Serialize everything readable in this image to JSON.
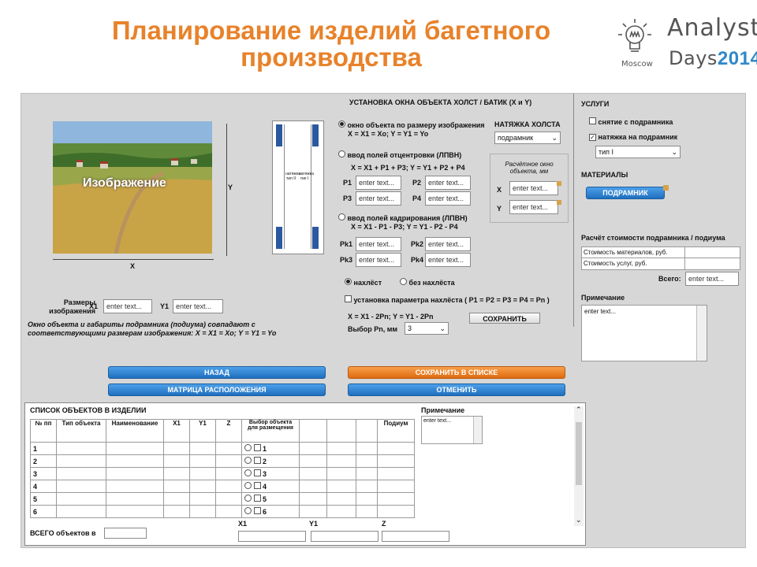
{
  "slide": {
    "title": "Планирование изделий багетного производства",
    "logo_line1": "Analyst",
    "logo_line2a": "Days",
    "logo_line2b": "2014",
    "logo_city": "Moscow"
  },
  "main": {
    "header": "УСТАНОВКА ОКНА ОБЪЕКТА ХОЛСТ / БАТИК  (X и  Y)",
    "image_label": "Изображение",
    "axis_x": "X",
    "axis_y": "Y",
    "stretch_label_1": "натяжка тип II",
    "stretch_label_2": "натяжка тип I",
    "options": [
      {
        "label": "окно объекта по размеру изображения",
        "formula": "X = X1 = Xo;  Y = Y1 = Yo",
        "selected": true
      },
      {
        "label": "ввод полей отцентровки (ЛПВН)",
        "formula": "X = X1 + P1 + P3;  Y = Y1 + P2 + P4",
        "selected": false
      },
      {
        "label": "ввод полей кадрирования (ЛПВН)",
        "formula": "X = X1 - P1 - P3;  Y = Y1 - P2 - P4",
        "selected": false
      }
    ],
    "p_fields": [
      {
        "label": "P1",
        "value": "enter text..."
      },
      {
        "label": "P2",
        "value": "enter text..."
      },
      {
        "label": "P3",
        "value": "enter text..."
      },
      {
        "label": "P4",
        "value": "enter text..."
      }
    ],
    "pk_fields": [
      {
        "label": "Pk1",
        "value": "enter text..."
      },
      {
        "label": "Pk2",
        "value": "enter text..."
      },
      {
        "label": "Pk3",
        "value": "enter text..."
      },
      {
        "label": "Pk4",
        "value": "enter text..."
      }
    ],
    "stretch_heading": "НАТЯЖКА ХОЛСТА",
    "stretch_select": "подрамник",
    "calc_window_title": "Расчётное окно объекта, мм",
    "calc_x_label": "X",
    "calc_y_label": "Y",
    "calc_x_value": "enter text...",
    "calc_y_value": "enter text...",
    "overlap_opt": "нахлёст",
    "no_overlap_opt": "без нахлёста",
    "overlap_param": "установка параметра нахлёста ( P1 = P2 = P3 = P4 = Pn )",
    "overlap_formula": "X = X1 - 2Pn;  Y = Y1 - 2Pn",
    "pn_label": "Выбор  Pn, мм",
    "pn_value": "3",
    "save_small": "СОХРАНИТЬ",
    "sizes_label": "Размеры изображения",
    "x1_label": "X1",
    "y1_label": "Y1",
    "x1_value": "enter text...",
    "y1_value": "enter text...",
    "note_text": "Окно объекта и габариты подрамника (подиума) совпадают с соответствующими размерам изображения: X = X1 = Xo;  Y = Y1 = Yo"
  },
  "right": {
    "services_heading": "УСЛУГИ",
    "service_1": "снятие с подрамника",
    "service_2": "натяжка на подрамник",
    "service_2_checked": true,
    "type_select": "тип I",
    "materials_heading": "МАТЕРИАЛЫ",
    "material_button": "ПОДРАМНИК",
    "cost_heading": "Расчёт стоимости подрамника / подиума",
    "cost_rows": [
      "Стоимость материалов, руб.",
      "Стоимость услуг, руб."
    ],
    "total_label": "Всего:",
    "total_value": "enter text...",
    "note_heading": "Примечание",
    "note_value": "enter text..."
  },
  "buttons": {
    "back": "НАЗАД",
    "matrix": "МАТРИЦА РАСПОЛОЖЕНИЯ",
    "save_list": "СОХРАНИТЬ В СПИСКЕ",
    "cancel": "ОТМЕНИТЬ"
  },
  "list": {
    "heading": "СПИСОК ОБЪЕКТОВ В ИЗДЕЛИИ",
    "columns": [
      "№ пп",
      "Тип объекта",
      "Наименование",
      "X1",
      "Y1",
      "Z",
      "Выбор объекта для размещения",
      "",
      "",
      "",
      "Подиум"
    ],
    "rows": [
      "1",
      "2",
      "3",
      "4",
      "5",
      "6"
    ],
    "note_heading": "Примечание",
    "note_value": "enter text...",
    "total_label": "ВСЕГО объектов в",
    "footer_x1": "X1",
    "footer_y1": "Y1",
    "footer_z": "Z"
  }
}
